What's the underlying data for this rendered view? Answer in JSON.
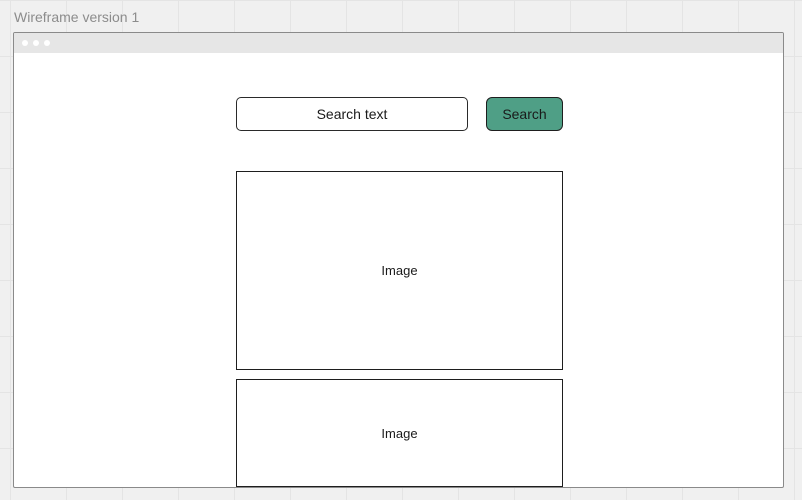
{
  "frame": {
    "title": "Wireframe version 1"
  },
  "search": {
    "input_text": "Search text",
    "button_label": "Search",
    "button_color": "#4f9f86"
  },
  "images": [
    {
      "label": "Image"
    },
    {
      "label": "Image"
    }
  ]
}
